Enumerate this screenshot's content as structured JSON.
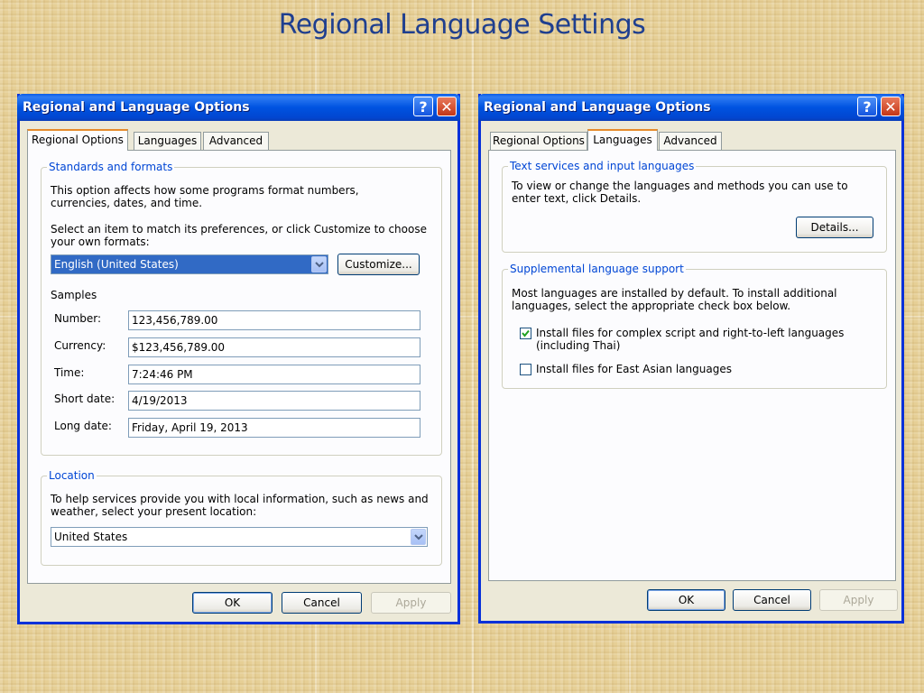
{
  "slide": {
    "title": "Regional Language Settings"
  },
  "left_dialog": {
    "window_title": "Regional and Language Options",
    "help_glyph": "?",
    "close_glyph": "✕",
    "tabs": [
      {
        "label": "Regional Options",
        "active": true
      },
      {
        "label": "Languages",
        "active": false
      },
      {
        "label": "Advanced",
        "active": false
      }
    ],
    "standards": {
      "legend": "Standards and formats",
      "description": "This option affects how some programs format numbers, currencies, dates, and time.",
      "instruction": "Select an item to match its preferences, or click Customize to choose your own formats:",
      "selected_format": "English (United States)",
      "customize_label": "Customize...",
      "samples_label": "Samples",
      "samples": [
        {
          "label": "Number:",
          "value": "123,456,789.00"
        },
        {
          "label": "Currency:",
          "value": "$123,456,789.00"
        },
        {
          "label": "Time:",
          "value": "7:24:46 PM"
        },
        {
          "label": "Short date:",
          "value": "4/19/2013"
        },
        {
          "label": "Long date:",
          "value": "Friday, April 19, 2013"
        }
      ]
    },
    "location": {
      "legend": "Location",
      "description": "To help services provide you with local information, such as news and weather, select your present location:",
      "selected_location": "United States"
    },
    "buttons": {
      "ok": "OK",
      "cancel": "Cancel",
      "apply": "Apply"
    }
  },
  "right_dialog": {
    "window_title": "Regional and Language Options",
    "help_glyph": "?",
    "close_glyph": "✕",
    "tabs": [
      {
        "label": "Regional Options",
        "active": false
      },
      {
        "label": "Languages",
        "active": true
      },
      {
        "label": "Advanced",
        "active": false
      }
    ],
    "text_services": {
      "legend": "Text services and input languages",
      "description": "To view or change the languages and methods you can use to enter text, click Details.",
      "details_label": "Details..."
    },
    "supplemental": {
      "legend": "Supplemental language support",
      "description": "Most languages are installed by default. To install additional languages, select the appropriate check box below.",
      "options": [
        {
          "label": "Install files for complex script and right-to-left languages (including Thai)",
          "checked": true
        },
        {
          "label": "Install files for East Asian languages",
          "checked": false
        }
      ]
    },
    "buttons": {
      "ok": "OK",
      "cancel": "Cancel",
      "apply": "Apply"
    }
  },
  "colors": {
    "title_blue": "#1f3f8f",
    "xp_blue": "#0053e1",
    "legend_blue": "#0046d5",
    "dialog_face": "#ece9d8",
    "selection": "#316ac5"
  }
}
